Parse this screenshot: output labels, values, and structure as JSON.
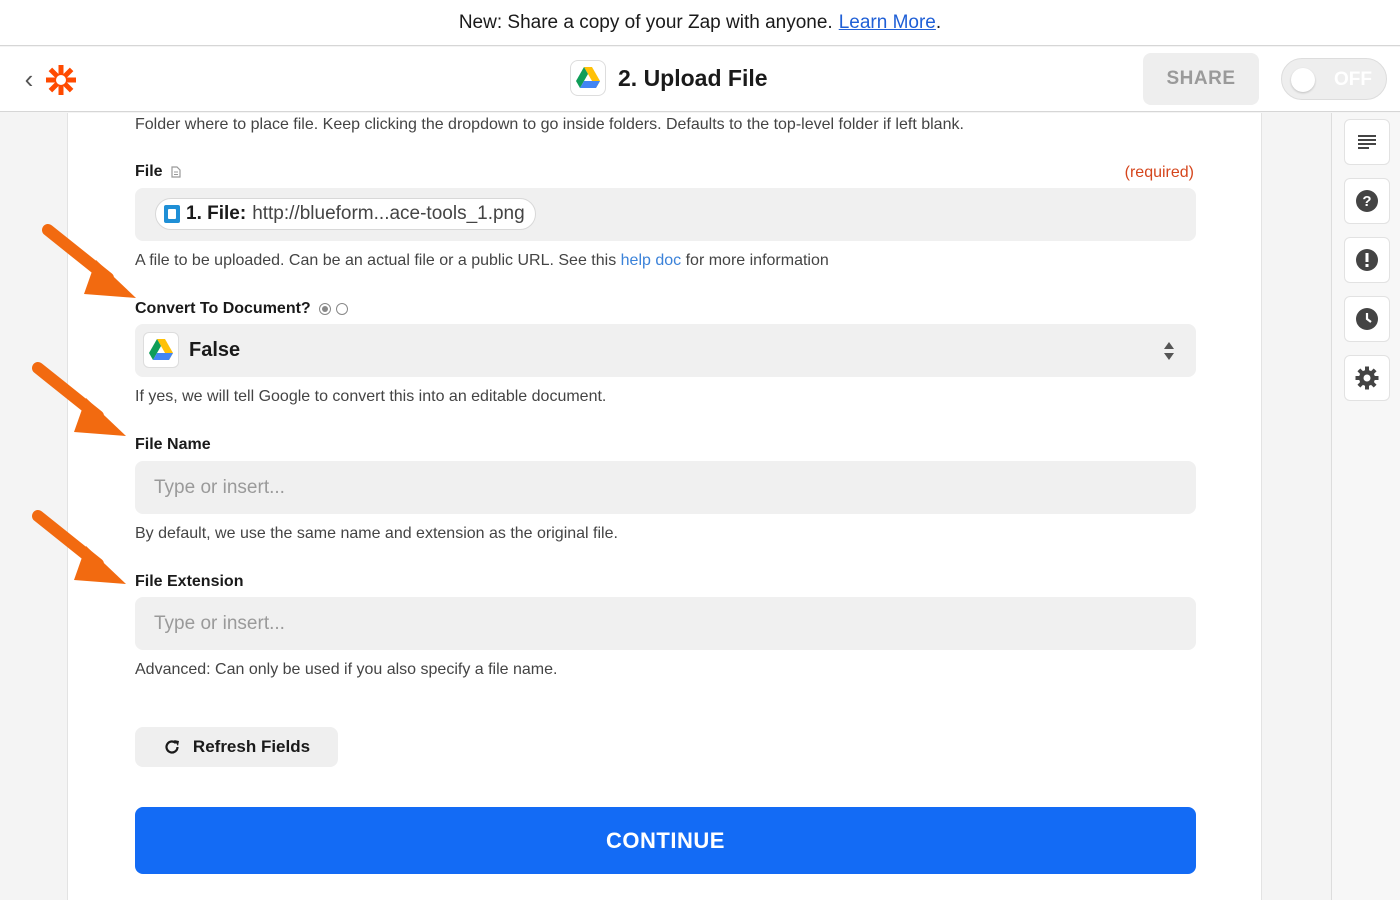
{
  "announcement": {
    "text": "New: Share a copy of your Zap with anyone.",
    "link": "Learn More",
    "suffix": "."
  },
  "header": {
    "title": "2. Upload File",
    "share_label": "SHARE",
    "toggle_label": "OFF"
  },
  "form": {
    "folder_help": "Folder where to place file. Keep clicking the dropdown to go inside folders. Defaults to the top-level folder if left blank.",
    "file": {
      "label": "File",
      "required": "(required)",
      "pill_step": "1. File:",
      "pill_value": "http://blueform...ace-tools_1.png",
      "help_pre": "A file to be uploaded. Can be an actual file or a public URL. See this",
      "help_link": "help doc",
      "help_post": "for more information"
    },
    "convert": {
      "label": "Convert To Document?",
      "value": "False",
      "help": "If yes, we will tell Google to convert this into an editable document."
    },
    "file_name": {
      "label": "File Name",
      "placeholder": "Type or insert...",
      "help": "By default, we use the same name and extension as the original file."
    },
    "file_extension": {
      "label": "File Extension",
      "placeholder": "Type or insert...",
      "help": "Advanced: Can only be used if you also specify a file name."
    },
    "refresh_label": "Refresh Fields",
    "continue_label": "CONTINUE"
  },
  "rail": {
    "icons": [
      "details-icon",
      "help-icon",
      "alert-icon",
      "history-icon",
      "settings-icon"
    ]
  },
  "colors": {
    "brand": "#ff4a00",
    "primary": "#136bf5",
    "required": "#d5461d",
    "arrow": "#f26a10",
    "link": "#3b82d9"
  }
}
